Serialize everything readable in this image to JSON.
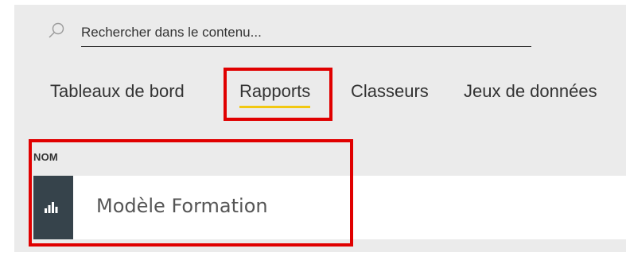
{
  "search": {
    "placeholder": "Rechercher dans le contenu..."
  },
  "tabs": [
    {
      "label": "Tableaux de bord",
      "active": false
    },
    {
      "label": "Rapports",
      "active": true
    },
    {
      "label": "Classeurs",
      "active": false
    },
    {
      "label": "Jeux de données",
      "active": false
    }
  ],
  "table": {
    "column_header": "NOM",
    "rows": [
      {
        "name": "Modèle Formation",
        "icon": "bar-chart-icon"
      }
    ]
  },
  "colors": {
    "highlight": "#e00000",
    "active_tab_underline": "#f2c811",
    "icon_tile": "#36434b",
    "panel_background": "#ebebeb"
  }
}
